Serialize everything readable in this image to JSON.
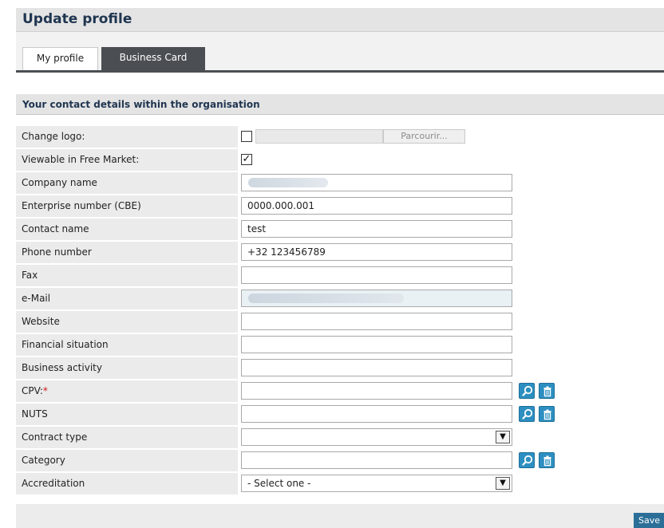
{
  "page": {
    "title": "Update profile"
  },
  "tabs": [
    {
      "label": "My profile",
      "active": false
    },
    {
      "label": "Business Card",
      "active": true
    }
  ],
  "section": {
    "title": "Your contact details within the organisation"
  },
  "form": {
    "change_logo": {
      "label": "Change logo:",
      "checked": false,
      "browse_label": "Parcourir..."
    },
    "viewable": {
      "label": "Viewable in Free Market:",
      "checked": true
    },
    "company_name": {
      "label": "Company name",
      "value": ""
    },
    "enterprise_number": {
      "label": "Enterprise number (CBE)",
      "value": "0000.000.001"
    },
    "contact_name": {
      "label": "Contact name",
      "value": "test"
    },
    "phone_number": {
      "label": "Phone number",
      "value": "+32 123456789"
    },
    "fax": {
      "label": "Fax",
      "value": ""
    },
    "email": {
      "label": "e-Mail",
      "value": ""
    },
    "website": {
      "label": "Website",
      "value": ""
    },
    "financial_situation": {
      "label": "Financial situation",
      "value": ""
    },
    "business_activity": {
      "label": "Business activity",
      "value": ""
    },
    "cpv": {
      "label": "CPV:",
      "required_mark": "*",
      "value": ""
    },
    "nuts": {
      "label": "NUTS",
      "value": ""
    },
    "contract_type": {
      "label": "Contract type",
      "selected": ""
    },
    "category": {
      "label": "Category",
      "value": ""
    },
    "accreditation": {
      "label": "Accreditation",
      "selected": "- Select one -"
    }
  },
  "footer": {
    "save_label": "Save"
  },
  "colors": {
    "accent": "#2d8fc1",
    "tab_active": "#4b4f54",
    "heading": "#1f3550",
    "required": "#d0161d"
  },
  "icons": {
    "search": "magnifier-icon",
    "delete": "trash-icon",
    "dropdown": "chevron-down-icon"
  }
}
